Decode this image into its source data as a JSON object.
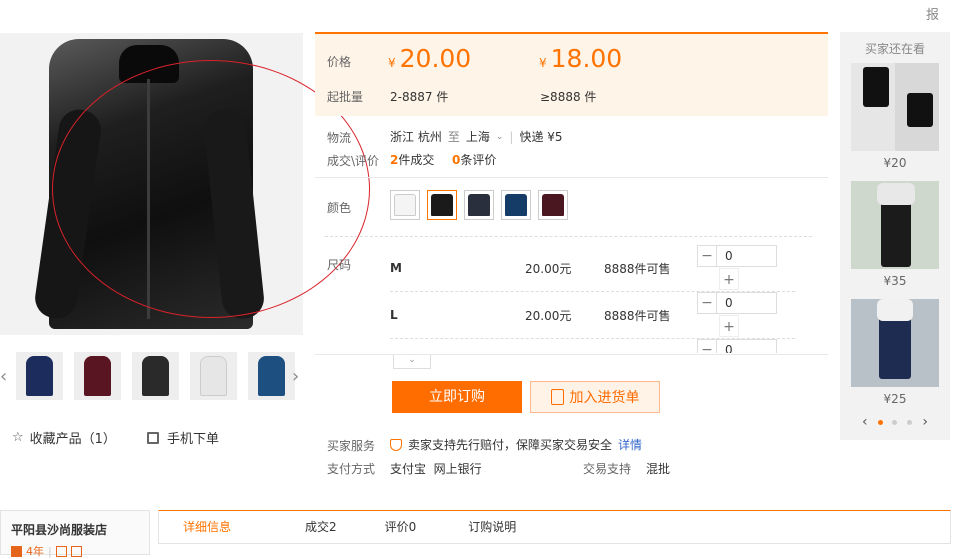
{
  "report": "报",
  "price": {
    "label": "价格",
    "yen": "¥",
    "price1": "20.00",
    "price2": "18.00",
    "moq_label": "起批量",
    "moq1": "2-8887 件",
    "moq2": "≥8888 件"
  },
  "logistics": {
    "label": "物流",
    "from": "浙江 杭州",
    "to_word": "至",
    "dest": "上海",
    "shipping": "快递 ¥5"
  },
  "deals": {
    "label": "成交\\评价",
    "count": "2",
    "count_suffix": "件成交",
    "reviews": "0",
    "reviews_suffix": "条评价"
  },
  "color_label": "颜色",
  "colors": [
    "#f4f4f4",
    "#1a1a1a",
    "#2a2f3e",
    "#153c66",
    "#4a1620"
  ],
  "size_label": "尺码",
  "skus": [
    {
      "size": "M",
      "price": "20.00元",
      "stock": "8888件可售",
      "qty": "0"
    },
    {
      "size": "L",
      "price": "20.00元",
      "stock": "8888件可售",
      "qty": "0"
    },
    {
      "qty": "0"
    }
  ],
  "actions": {
    "buy": "立即订购",
    "cart": "加入进货单"
  },
  "service": {
    "label": "买家服务",
    "text": "卖家支持先行赔付，保障买家交易安全",
    "link": "详情",
    "pay_label": "支付方式",
    "pay_methods": "支付宝  网上银行",
    "trade_label": "交易支持",
    "trade_value": "混批"
  },
  "gallery": {
    "favorite": "收藏产品（1）",
    "mobile": "手机下单",
    "thumb_colors": [
      "#1c2c5c",
      "#5a1522",
      "#2a2a2a",
      "#e6e6e6",
      "#1d4f80"
    ]
  },
  "rail": {
    "title": "买家还在看",
    "items": [
      {
        "price": "¥20"
      },
      {
        "price": "¥35"
      },
      {
        "price": "¥25"
      }
    ]
  },
  "shop": {
    "name": "平阳县沙尚服装店",
    "years": "4年"
  },
  "tabs": [
    "详细信息",
    "成交2",
    "评价0",
    "订购说明"
  ]
}
